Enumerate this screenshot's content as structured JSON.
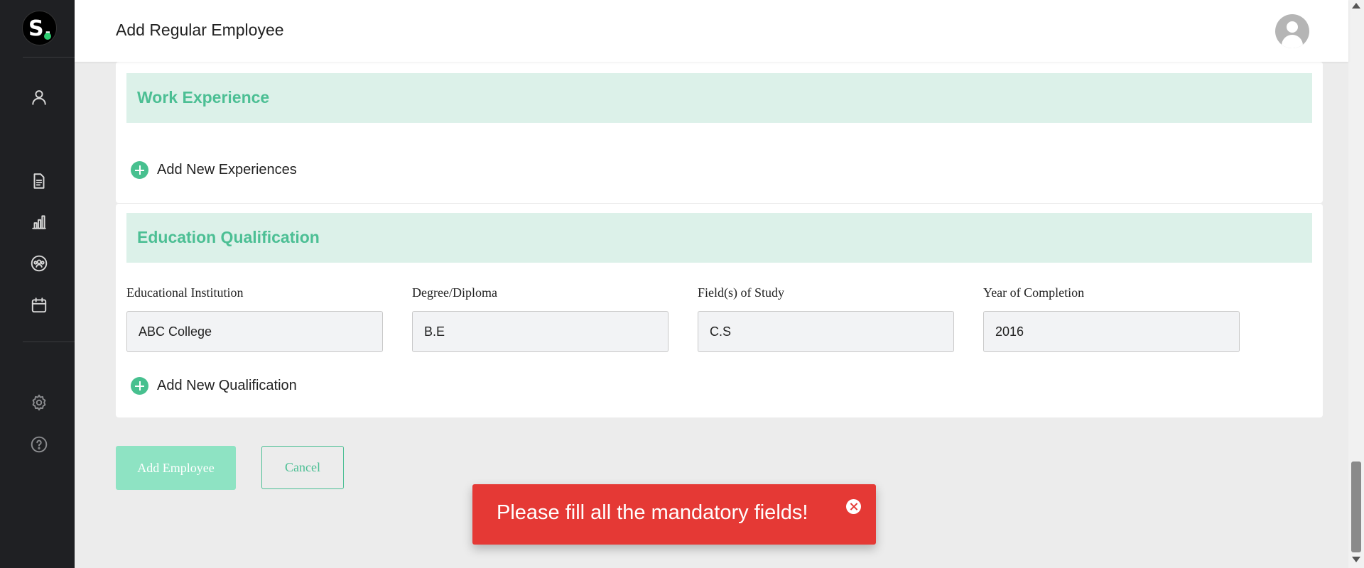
{
  "app": {
    "logo_letter": "S."
  },
  "sidebar": {
    "items": [
      {
        "icon": "user-icon"
      },
      {
        "icon": "document-icon"
      },
      {
        "icon": "bar-chart-icon"
      },
      {
        "icon": "team-icon"
      },
      {
        "icon": "calendar-icon"
      },
      {
        "icon": "settings-icon"
      },
      {
        "icon": "help-icon"
      }
    ]
  },
  "header": {
    "title": "Add Regular Employee",
    "avatar_icon": "user-avatar-icon"
  },
  "work_experience": {
    "title": "Work Experience",
    "add_label": "Add New Experiences"
  },
  "education": {
    "title": "Education Qualification",
    "fields": [
      {
        "label": "Educational Institution",
        "value": "ABC College"
      },
      {
        "label": "Degree/Diploma",
        "value": "B.E"
      },
      {
        "label": "Field(s) of Study",
        "value": "C.S"
      },
      {
        "label": "Year of Completion",
        "value": "2016"
      }
    ],
    "add_label": "Add New Qualification"
  },
  "actions": {
    "add_label": "Add Employee",
    "cancel_label": "Cancel"
  },
  "toast": {
    "message": "Please fill all the mandatory fields!",
    "color": "#e53935"
  },
  "theme": {
    "accent": "#4cbf94",
    "accent_light": "#dcf1e9",
    "sidebar_bg": "#1f2023"
  }
}
